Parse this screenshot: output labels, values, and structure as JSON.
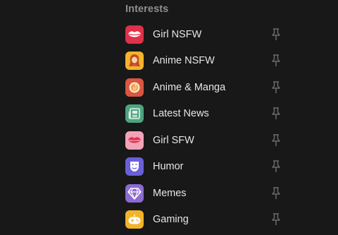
{
  "section": {
    "title": "Interests"
  },
  "items": [
    {
      "label": "Girl NSFW",
      "icon": "lips-icon",
      "color": "#e0304a"
    },
    {
      "label": "Anime NSFW",
      "icon": "anime-girl-icon",
      "color": "#f2b52a"
    },
    {
      "label": "Anime & Manga",
      "icon": "sushi-icon",
      "color": "#d9563f"
    },
    {
      "label": "Latest News",
      "icon": "newspaper-icon",
      "color": "#4fa37f"
    },
    {
      "label": "Girl SFW",
      "icon": "lips-icon",
      "color": "#f2a3b8"
    },
    {
      "label": "Humor",
      "icon": "mask-icon",
      "color": "#6a5fd8"
    },
    {
      "label": "Memes",
      "icon": "diamond-icon",
      "color": "#8b6bd0"
    },
    {
      "label": "Gaming",
      "icon": "gamepad-icon",
      "color": "#f2b527"
    }
  ],
  "pin_icon": "pin-icon",
  "colors": {
    "background": "#181818",
    "title": "#8e8e8e",
    "label": "#e6e6e6",
    "pin": "#6a6a6a"
  }
}
